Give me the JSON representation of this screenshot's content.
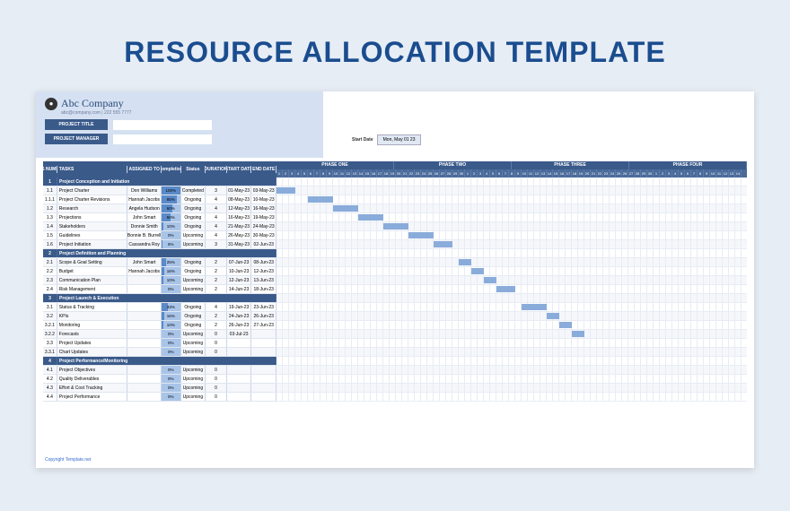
{
  "page_title": "RESOURCE ALLOCATION TEMPLATE",
  "company": {
    "name": "Abc Company",
    "sub": "abc@company.com | 222 555 7777"
  },
  "fields": {
    "project_title_label": "PROJECT TITLE",
    "project_manager_label": "PROJECT MANAGER",
    "start_date_label": "Start Date",
    "start_date_value": "Mon, May 01 23"
  },
  "headers": {
    "wbs": "WBS NUMBER",
    "tasks": "TASKS",
    "assigned": "ASSIGNED TO",
    "completion": "Completion",
    "status": "Status",
    "duration": "DURATION",
    "start": "START DATE",
    "end": "END DATE"
  },
  "phases": [
    "PHASE ONE",
    "PHASE TWO",
    "PHASE THREE",
    "PHASE FOUR"
  ],
  "rows": [
    {
      "wbs": "1",
      "task": "Project Conception and Initiation",
      "phase": true
    },
    {
      "wbs": "1.1",
      "task": "Project Charter",
      "asn": "Don Williams",
      "cmp": 100,
      "sta": "Completed",
      "dur": "3",
      "sd": "01-May-23",
      "ed": "03-May-23",
      "bar": [
        0,
        3
      ]
    },
    {
      "wbs": "1.1.1",
      "task": "Project Charter Revisions",
      "asn": "Hannah Jacobs",
      "cmp": 85,
      "sta": "Ongoing",
      "dur": "4",
      "sd": "08-May-23",
      "ed": "10-May-23",
      "bar": [
        5,
        4
      ]
    },
    {
      "wbs": "1.2",
      "task": "Research",
      "asn": "Angela Hudson",
      "cmp": 60,
      "sta": "Ongoing",
      "dur": "4",
      "sd": "12-May-23",
      "ed": "16-May-23",
      "bar": [
        9,
        4
      ]
    },
    {
      "wbs": "1.3",
      "task": "Projections",
      "asn": "John Smart",
      "cmp": 50,
      "sta": "Ongoing",
      "dur": "4",
      "sd": "16-May-23",
      "ed": "19-May-23",
      "bar": [
        13,
        4
      ]
    },
    {
      "wbs": "1.4",
      "task": "Stakeholders",
      "asn": "Donnie Smith",
      "cmp": 10,
      "sta": "Ongoing",
      "dur": "4",
      "sd": "21-May-23",
      "ed": "24-May-23",
      "bar": [
        17,
        4
      ]
    },
    {
      "wbs": "1.5",
      "task": "Guidelines",
      "asn": "Bonnie B. Burrell",
      "cmp": 0,
      "sta": "Upcoming",
      "dur": "4",
      "sd": "26-May-23",
      "ed": "30-May-23",
      "bar": [
        21,
        4
      ]
    },
    {
      "wbs": "1.6",
      "task": "Project Initiation",
      "asn": "Cassandra Roy",
      "cmp": 5,
      "sta": "Upcoming",
      "dur": "3",
      "sd": "31-May-23",
      "ed": "02-Jun-23",
      "bar": [
        25,
        3
      ]
    },
    {
      "wbs": "2",
      "task": "Project Definition and Planning",
      "phase": true
    },
    {
      "wbs": "2.1",
      "task": "Scope & Goal Setting",
      "asn": "John Smart",
      "cmp": 25,
      "sta": "Ongoing",
      "dur": "2",
      "sd": "07-Jun-23",
      "ed": "08-Jun-23",
      "bar": [
        29,
        2
      ]
    },
    {
      "wbs": "2.2",
      "task": "Budget",
      "asn": "Hannah Jacobs",
      "cmp": 16,
      "sta": "Ongoing",
      "dur": "2",
      "sd": "10-Jun-23",
      "ed": "12-Jun-23",
      "bar": [
        31,
        2
      ]
    },
    {
      "wbs": "2.3",
      "task": "Communication Plan",
      "asn": "",
      "cmp": 10,
      "sta": "Upcoming",
      "dur": "2",
      "sd": "12-Jun-23",
      "ed": "13-Jun-23",
      "bar": [
        33,
        2
      ]
    },
    {
      "wbs": "2.4",
      "task": "Risk Management",
      "asn": "",
      "cmp": 0,
      "sta": "Upcoming",
      "dur": "2",
      "sd": "14-Jun-23",
      "ed": "18-Jun-23",
      "bar": [
        35,
        3
      ]
    },
    {
      "wbs": "3",
      "task": "Project Launch & Execution",
      "phase": true
    },
    {
      "wbs": "3.1",
      "task": "Status & Tracking",
      "asn": "",
      "cmp": 33,
      "sta": "Ongoing",
      "dur": "4",
      "sd": "19-Jun-23",
      "ed": "23-Jun-23",
      "bar": [
        39,
        4
      ]
    },
    {
      "wbs": "3.2",
      "task": "KPIs",
      "asn": "",
      "cmp": 16,
      "sta": "Ongoing",
      "dur": "2",
      "sd": "24-Jun-23",
      "ed": "26-Jun-23",
      "bar": [
        43,
        2
      ]
    },
    {
      "wbs": "3.2.1",
      "task": "Monitoring",
      "asn": "",
      "cmp": 10,
      "sta": "Ongoing",
      "dur": "2",
      "sd": "26-Jun-23",
      "ed": "27-Jun-23",
      "bar": [
        45,
        2
      ]
    },
    {
      "wbs": "3.2.2",
      "task": "Forecasts",
      "asn": "",
      "cmp": 0,
      "sta": "Upcoming",
      "dur": "0",
      "sd": "03-Jul-23",
      "ed": "",
      "bar": [
        47,
        2
      ]
    },
    {
      "wbs": "3.3",
      "task": "Project Updates",
      "asn": "",
      "cmp": 0,
      "sta": "Upcoming",
      "dur": "0",
      "sd": "",
      "ed": "",
      "bar": null
    },
    {
      "wbs": "3.3.1",
      "task": "Chart Updates",
      "asn": "",
      "cmp": 0,
      "sta": "Upcoming",
      "dur": "0",
      "sd": "",
      "ed": "",
      "bar": null
    },
    {
      "wbs": "4",
      "task": "Project Performance/Monitoring",
      "phase": true
    },
    {
      "wbs": "4.1",
      "task": "Project Objectives",
      "asn": "",
      "cmp": 0,
      "sta": "Upcoming",
      "dur": "0",
      "sd": "",
      "ed": "",
      "bar": null
    },
    {
      "wbs": "4.2",
      "task": "Quality Deliverables",
      "asn": "",
      "cmp": 0,
      "sta": "Upcoming",
      "dur": "0",
      "sd": "",
      "ed": "",
      "bar": null
    },
    {
      "wbs": "4.3",
      "task": "Effort & Cost Tracking",
      "asn": "",
      "cmp": 0,
      "sta": "Upcoming",
      "dur": "0",
      "sd": "",
      "ed": "",
      "bar": null
    },
    {
      "wbs": "4.4",
      "task": "Project Performance",
      "asn": "",
      "cmp": 0,
      "sta": "Upcoming",
      "dur": "0",
      "sd": "",
      "ed": "",
      "bar": null
    }
  ],
  "copyright": "Copyright Template.net",
  "day_count": 74
}
